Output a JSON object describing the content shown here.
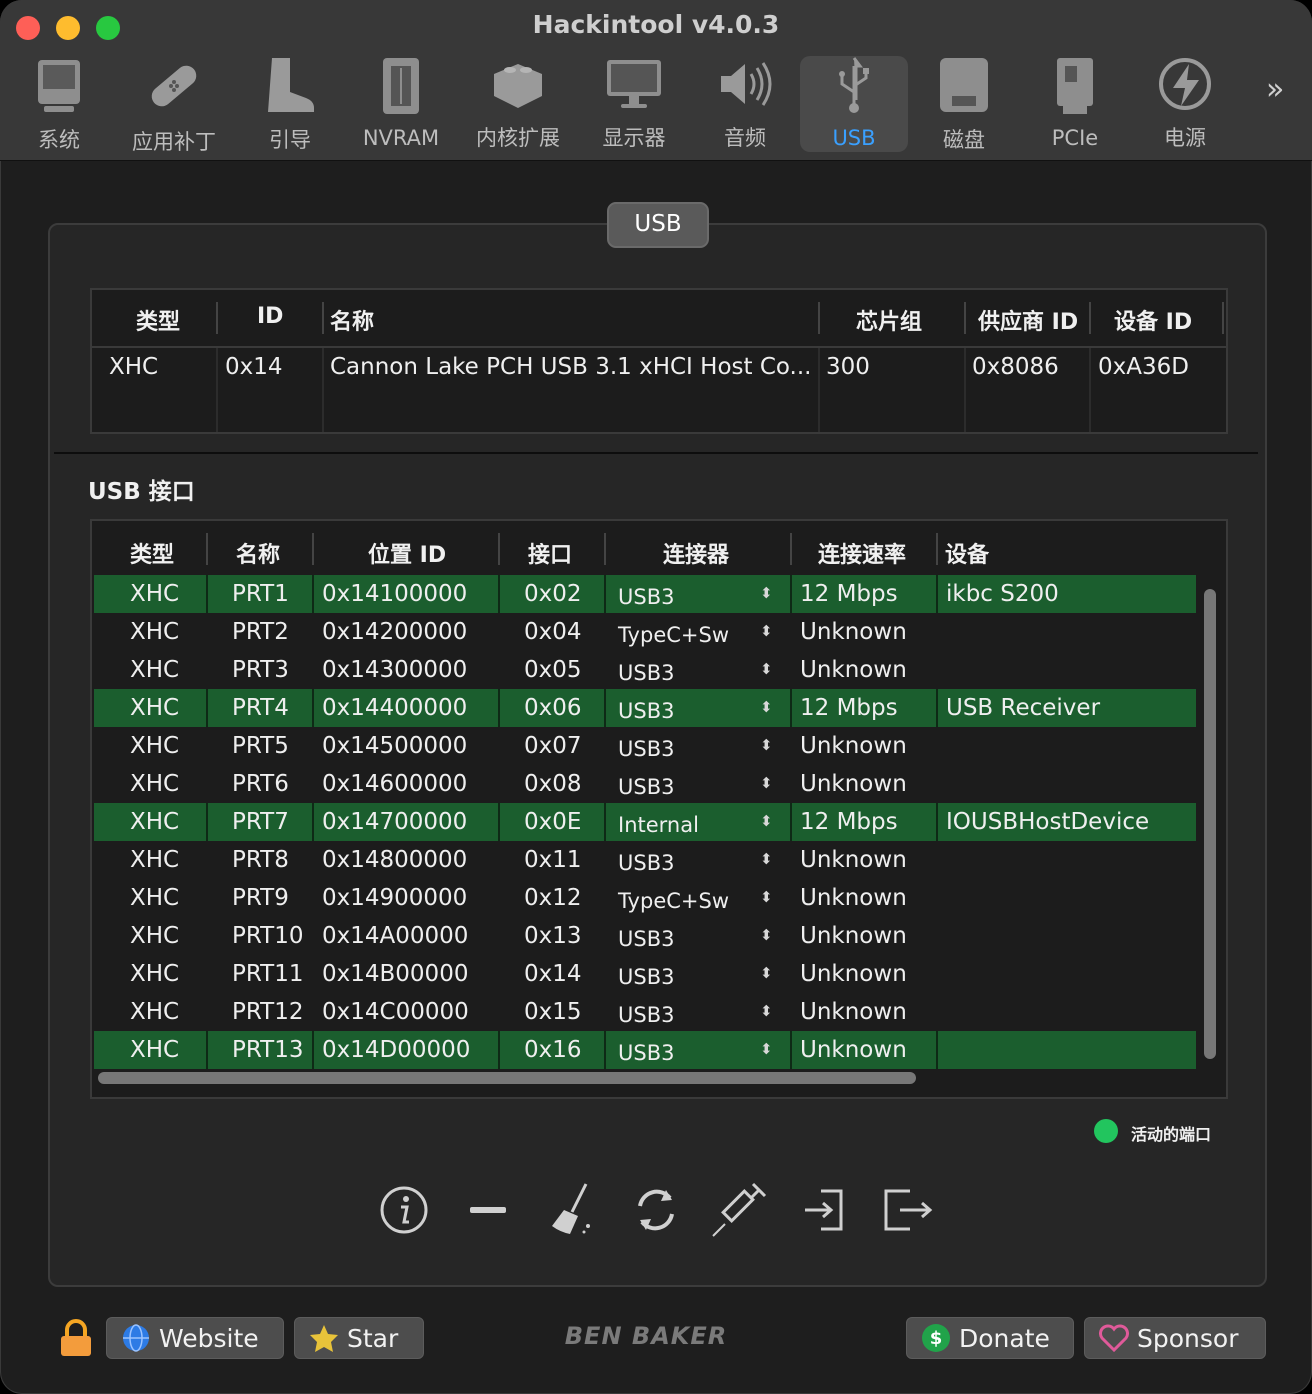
{
  "window": {
    "title": "Hackintool v4.0.3"
  },
  "toolbar": {
    "items": [
      {
        "label": "系统",
        "icon": "computer-icon"
      },
      {
        "label": "应用补丁",
        "icon": "bandage-icon"
      },
      {
        "label": "引导",
        "icon": "boot-icon"
      },
      {
        "label": "NVRAM",
        "icon": "memory-chip-icon"
      },
      {
        "label": "内核扩展",
        "icon": "brick-icon"
      },
      {
        "label": "显示器",
        "icon": "display-icon"
      },
      {
        "label": "音频",
        "icon": "speaker-icon"
      },
      {
        "label": "USB",
        "icon": "usb-icon",
        "active": true
      },
      {
        "label": "磁盘",
        "icon": "disk-icon"
      },
      {
        "label": "PCIe",
        "icon": "pcie-card-icon"
      },
      {
        "label": "电源",
        "icon": "power-bolt-icon"
      }
    ],
    "more": "»"
  },
  "panel": {
    "tab": "USB"
  },
  "controllers": {
    "headers": [
      "类型",
      "ID",
      "名称",
      "芯片组",
      "供应商 ID",
      "设备 ID"
    ],
    "rows": [
      [
        "XHC",
        "0x14",
        "Cannon Lake PCH USB 3.1 xHCI Host Co...",
        "300",
        "0x8086",
        "0xA36D"
      ]
    ]
  },
  "ports": {
    "title": "USB 接口",
    "headers": [
      "类型",
      "名称",
      "位置 ID",
      "接口",
      "连接器",
      "连接速率",
      "设备"
    ],
    "rows": [
      {
        "type": "XHC",
        "name": "PRT1",
        "location": "0x14100000",
        "port": "0x02",
        "connector": "USB3",
        "speed": "12 Mbps",
        "device": "ikbc S200",
        "active": true
      },
      {
        "type": "XHC",
        "name": "PRT2",
        "location": "0x14200000",
        "port": "0x04",
        "connector": "TypeC+Sw",
        "speed": "Unknown",
        "device": "",
        "active": false
      },
      {
        "type": "XHC",
        "name": "PRT3",
        "location": "0x14300000",
        "port": "0x05",
        "connector": "USB3",
        "speed": "Unknown",
        "device": "",
        "active": false
      },
      {
        "type": "XHC",
        "name": "PRT4",
        "location": "0x14400000",
        "port": "0x06",
        "connector": "USB3",
        "speed": "12 Mbps",
        "device": "USB Receiver",
        "active": true
      },
      {
        "type": "XHC",
        "name": "PRT5",
        "location": "0x14500000",
        "port": "0x07",
        "connector": "USB3",
        "speed": "Unknown",
        "device": "",
        "active": false
      },
      {
        "type": "XHC",
        "name": "PRT6",
        "location": "0x14600000",
        "port": "0x08",
        "connector": "USB3",
        "speed": "Unknown",
        "device": "",
        "active": false
      },
      {
        "type": "XHC",
        "name": "PRT7",
        "location": "0x14700000",
        "port": "0x0E",
        "connector": "Internal",
        "speed": "12 Mbps",
        "device": "IOUSBHostDevice",
        "active": true
      },
      {
        "type": "XHC",
        "name": "PRT8",
        "location": "0x14800000",
        "port": "0x11",
        "connector": "USB3",
        "speed": "Unknown",
        "device": "",
        "active": false
      },
      {
        "type": "XHC",
        "name": "PRT9",
        "location": "0x14900000",
        "port": "0x12",
        "connector": "TypeC+Sw",
        "speed": "Unknown",
        "device": "",
        "active": false
      },
      {
        "type": "XHC",
        "name": "PRT10",
        "location": "0x14A00000",
        "port": "0x13",
        "connector": "USB3",
        "speed": "Unknown",
        "device": "",
        "active": false
      },
      {
        "type": "XHC",
        "name": "PRT11",
        "location": "0x14B00000",
        "port": "0x14",
        "connector": "USB3",
        "speed": "Unknown",
        "device": "",
        "active": false
      },
      {
        "type": "XHC",
        "name": "PRT12",
        "location": "0x14C00000",
        "port": "0x15",
        "connector": "USB3",
        "speed": "Unknown",
        "device": "",
        "active": false
      },
      {
        "type": "XHC",
        "name": "PRT13",
        "location": "0x14D00000",
        "port": "0x16",
        "connector": "USB3",
        "speed": "Unknown",
        "device": "",
        "active": true
      }
    ]
  },
  "legend": {
    "label": "活动的端口",
    "color": "#22c55e"
  },
  "actions": [
    "info-icon",
    "minus-icon",
    "broom-icon",
    "refresh-icon",
    "syringe-icon",
    "import-icon",
    "export-icon"
  ],
  "footer": {
    "website": "Website",
    "star": "Star",
    "brand": "BEN BAKER",
    "donate": "Donate",
    "sponsor": "Sponsor"
  },
  "colors": {
    "active_row": "#1b5e2e",
    "selected_tab_text": "#3aa0ff"
  }
}
